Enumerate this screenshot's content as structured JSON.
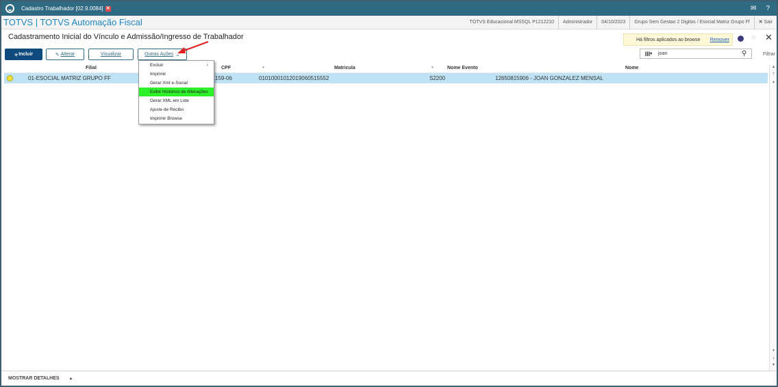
{
  "window": {
    "title": "Cadastro Trabalhador [02.9.0084]",
    "close_glyph": "✕"
  },
  "app": {
    "title": "TOTVS | TOTVS Automação Fiscal",
    "info": {
      "environment": "TOTVS Educacional MSSQL P1212210",
      "user": "Administrador",
      "date": "04/10/2023",
      "group": "Grupo Sem Gestao 2 Digitos / Esocial Matriz Grupo Ff",
      "exit_label": "Sair"
    }
  },
  "page": {
    "title": "Cadastramento Inicial do Vínculo e Admissão/Ingresso de Trabalhador",
    "filter_notice": "Há filtros aplicados ao browse",
    "remove_label": "Remover"
  },
  "toolbar": {
    "include_label": "Incluir",
    "edit_label": "Alterar",
    "view_label": "Visualizar",
    "more_label": "Outras Ações"
  },
  "search": {
    "value": "joan",
    "filter_label": "Filtrar"
  },
  "grid": {
    "columns": [
      "Filial",
      "CPF",
      "Matricula",
      "Nome Evento",
      "Nome"
    ],
    "rows": [
      {
        "filial": "01-ESOCIAL MATRIZ GRUPO FF",
        "cpf": "159-06",
        "matricula": "01010001012019060515552",
        "evento": "S2200",
        "nome": "12650815906 - JOAN GONZALEZ MENSAL"
      }
    ]
  },
  "menu": {
    "items": [
      "Excluir",
      "Imprimir",
      "Gerar Xml e-Social",
      "Exibir Histórico de Alterações",
      "Gerar XML em Lote",
      "Ajuste de Recibo",
      "Imprimir Browse"
    ],
    "highlighted_index": 3
  },
  "footer": {
    "details_label": "MOSTRAR DETALHES"
  },
  "colors": {
    "titlebar": "#2f6a83",
    "accent": "#1d86c2",
    "row_selected": "#bfe3f4",
    "menu_highlight": "#2ef02a",
    "annotation_arrow": "#e02020"
  }
}
